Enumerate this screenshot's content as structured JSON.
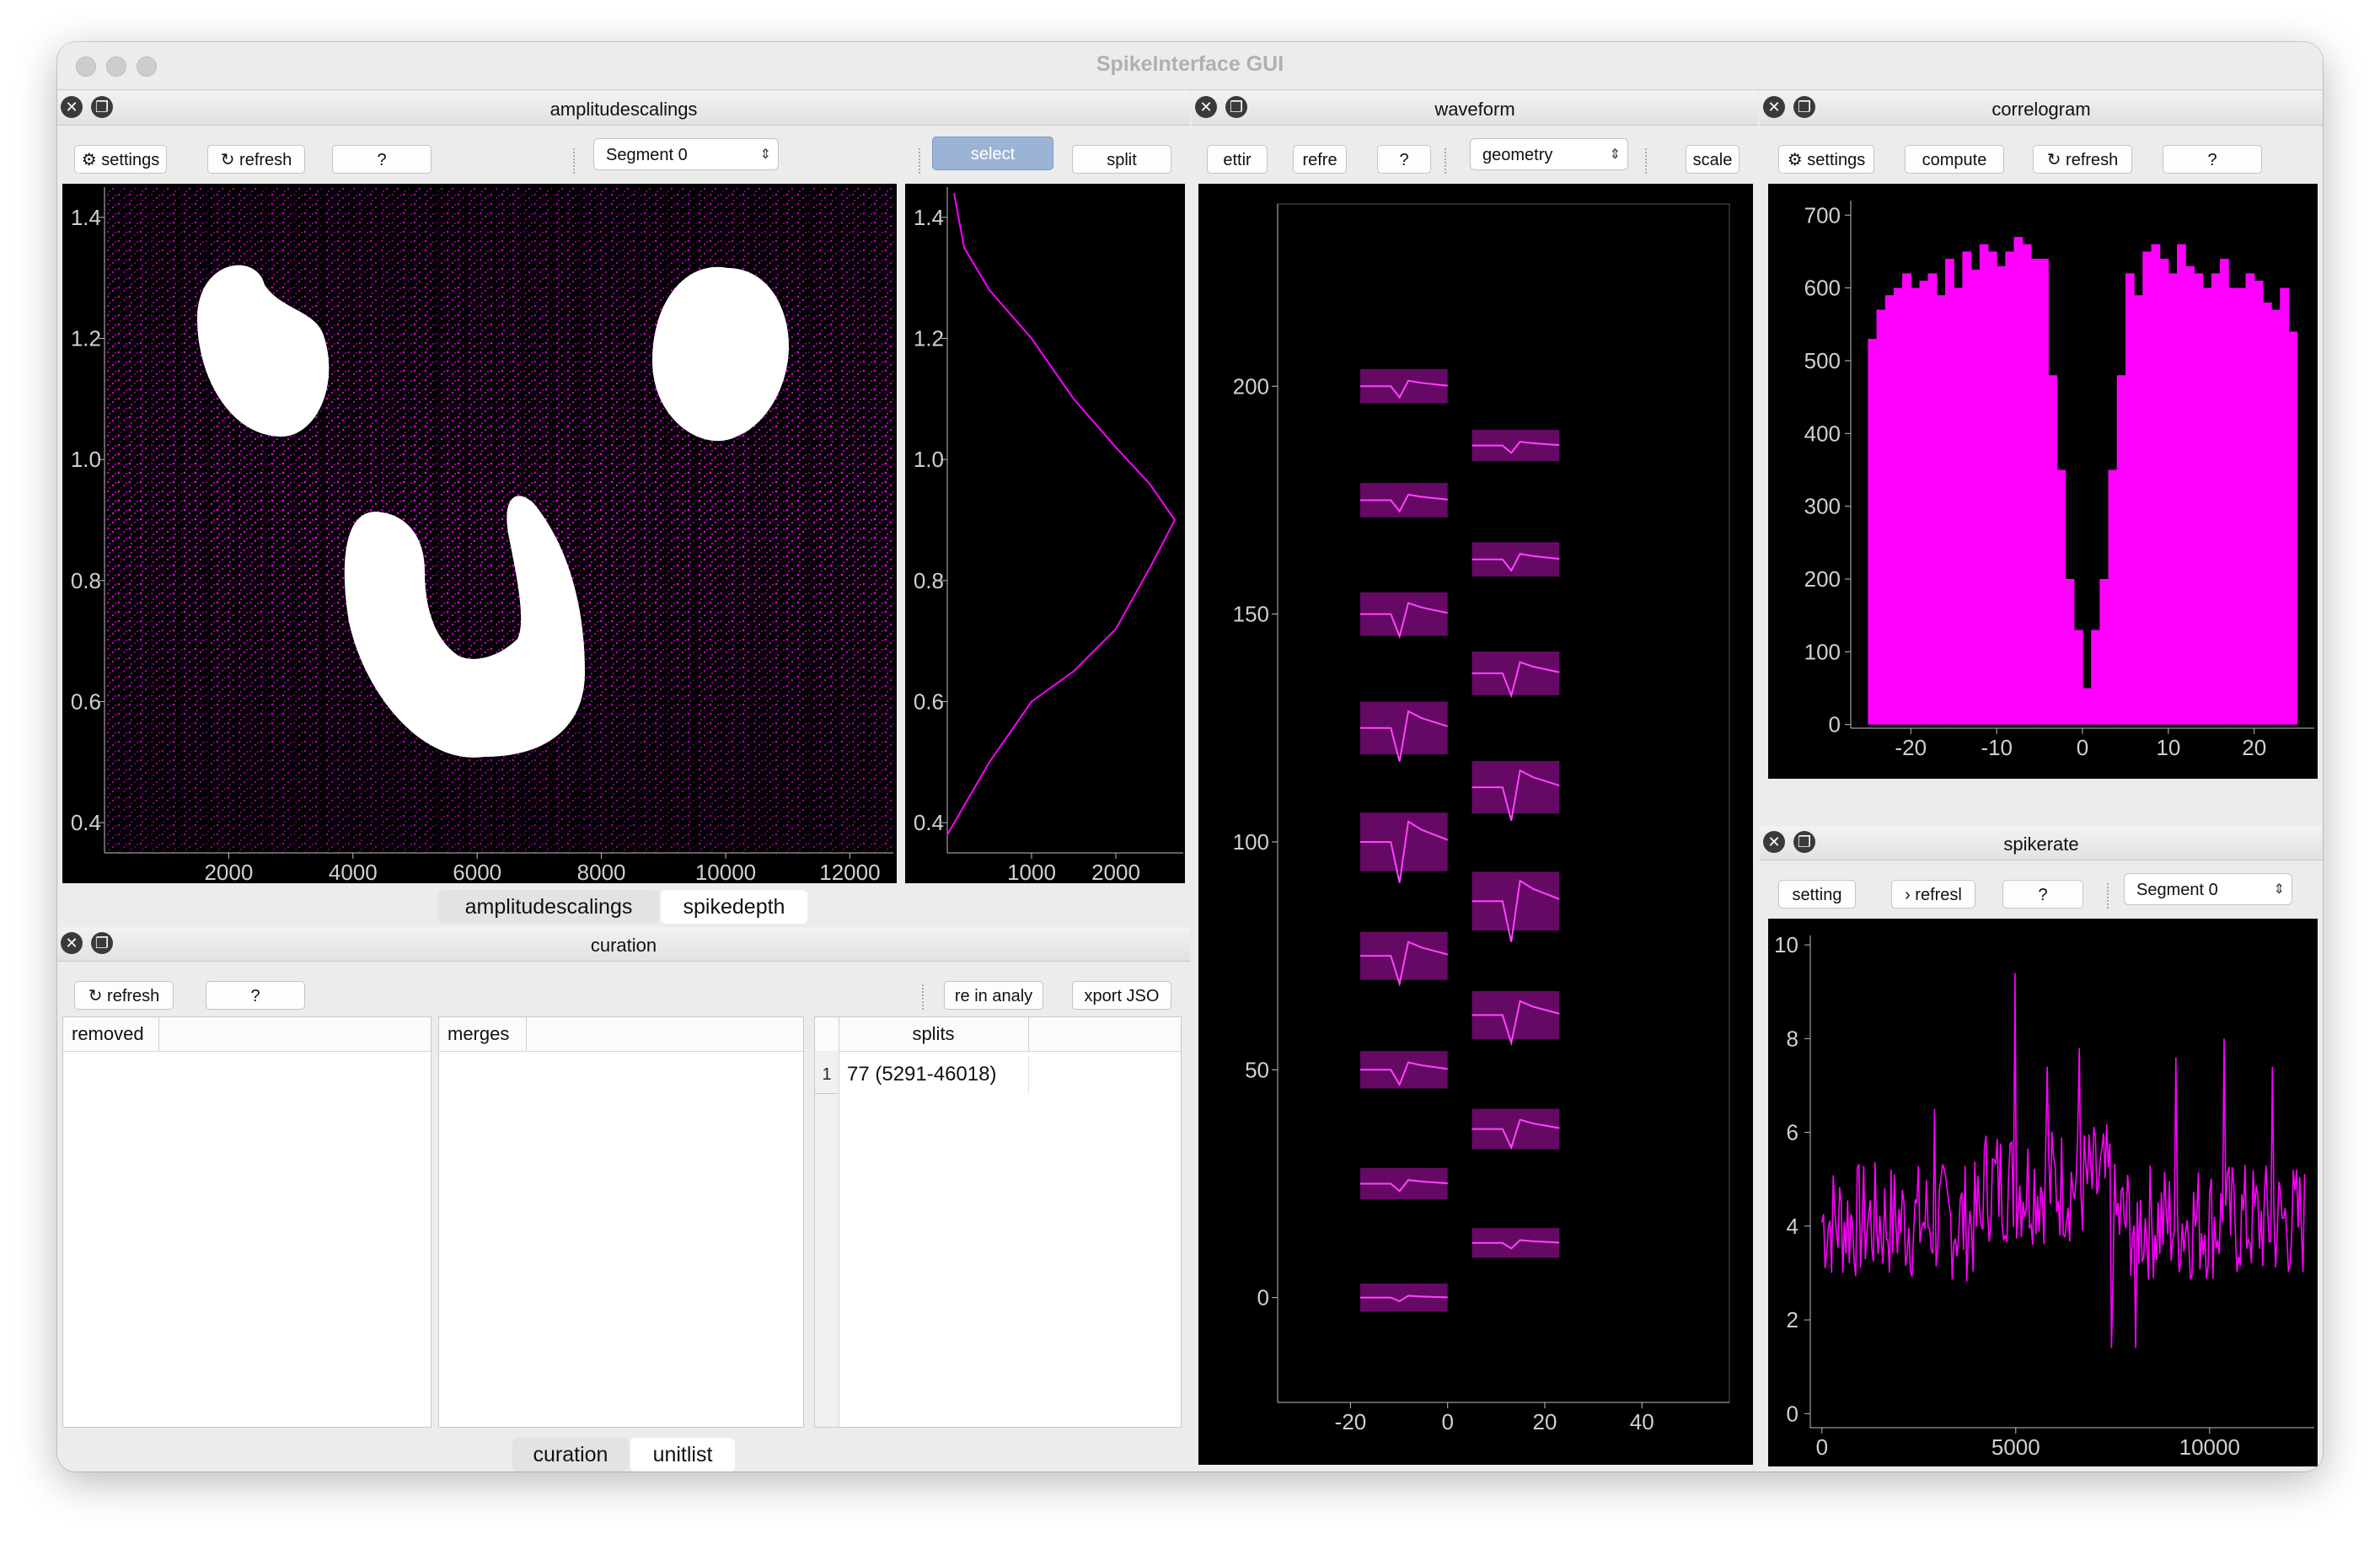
{
  "window": {
    "title": "SpikeInterface GUI"
  },
  "colors": {
    "accent": "#ff00ff",
    "plot_bg": "#000000",
    "axis": "#bfbfbf",
    "panel_bg": "#ececec"
  },
  "amplitudescalings": {
    "title": "amplitudescalings",
    "toolbar": {
      "settings": "⚙ settings",
      "refresh": "↻ refresh",
      "help": "?",
      "segment": "Segment 0",
      "select": "select",
      "split": "split"
    },
    "main_plot": {
      "x_ticks": [
        "2000",
        "4000",
        "6000",
        "8000",
        "10000",
        "12000"
      ],
      "y_ticks": [
        "1.4",
        "1.2",
        "1.0",
        "0.8",
        "0.6",
        "0.4"
      ]
    },
    "hist_plot": {
      "x_ticks": [
        "1000",
        "2000"
      ],
      "y_ticks": [
        "1.4",
        "1.2",
        "1.0",
        "0.8",
        "0.6",
        "0.4"
      ]
    }
  },
  "tabs_top": [
    "amplitudescalings",
    "spikedepth"
  ],
  "curation": {
    "title": "curation",
    "toolbar": {
      "refresh": "↻ refresh",
      "help": "?",
      "save": "re in analy",
      "export": "xport JSO"
    },
    "removed": {
      "header": "removed"
    },
    "merges": {
      "header": "merges"
    },
    "splits": {
      "header": "splits",
      "rows": [
        {
          "index": "1",
          "value": "77 (5291-46018)"
        }
      ]
    }
  },
  "tabs_bottom": [
    "curation",
    "unitlist"
  ],
  "waveform": {
    "title": "waveform",
    "toolbar": {
      "settings": "ettir",
      "refresh": "refre",
      "help": "?",
      "mode": "geometry",
      "scale": "scale"
    },
    "x_ticks": [
      "-20",
      "0",
      "20",
      "40"
    ],
    "y_ticks": [
      "200",
      "150",
      "100",
      "50",
      "0"
    ]
  },
  "correlogram": {
    "title": "correlogram",
    "toolbar": {
      "settings": "⚙ settings",
      "compute": "compute",
      "refresh": "↻ refresh",
      "help": "?"
    },
    "x_ticks": [
      "-20",
      "-10",
      "0",
      "10",
      "20"
    ],
    "y_ticks": [
      "700",
      "600",
      "500",
      "400",
      "300",
      "200",
      "100",
      "0"
    ]
  },
  "spikerate": {
    "title": "spikerate",
    "toolbar": {
      "settings": "setting",
      "refresh": "› refresl",
      "help": "?",
      "segment": "Segment 0"
    },
    "x_ticks": [
      "0",
      "5000",
      "10000"
    ],
    "y_ticks": [
      "10",
      "8",
      "6",
      "4",
      "2",
      "0"
    ]
  },
  "chart_data": [
    {
      "type": "scatter",
      "x": [
        2000,
        4000,
        6000,
        8000,
        10000,
        12000
      ],
      "y": [
        0.4,
        0.6,
        0.8,
        1.0,
        1.2,
        1.4
      ],
      "xlim": [
        0,
        12700
      ],
      "ylim": [
        0.35,
        1.45
      ]
    },
    {
      "type": "line",
      "x": [
        0,
        500,
        1000,
        1500,
        2000,
        2400,
        2700,
        2400,
        2000,
        1500,
        1000,
        500,
        200,
        80
      ],
      "y": [
        0.38,
        0.5,
        0.6,
        0.65,
        0.72,
        0.82,
        0.9,
        0.96,
        1.02,
        1.1,
        1.2,
        1.28,
        1.35,
        1.44
      ],
      "xlim": [
        0,
        2800
      ],
      "ylim": [
        0.35,
        1.45
      ]
    },
    {
      "type": "bar",
      "x": [
        -25,
        -24,
        -23,
        -22,
        -21,
        -20,
        -19,
        -18,
        -17,
        -16,
        -15,
        -14,
        -13,
        -12,
        -11,
        -10,
        -9,
        -8,
        -7,
        -6,
        -5,
        -4,
        -3,
        -2,
        -1,
        0,
        1,
        2,
        3,
        4,
        5,
        6,
        7,
        8,
        9,
        10,
        11,
        12,
        13,
        14,
        15,
        16,
        17,
        18,
        19,
        20,
        21,
        22,
        23,
        24
      ],
      "values": [
        530,
        570,
        590,
        600,
        620,
        600,
        610,
        620,
        590,
        640,
        600,
        650,
        625,
        660,
        650,
        630,
        650,
        670,
        660,
        640,
        640,
        480,
        350,
        200,
        130,
        50,
        130,
        200,
        350,
        480,
        620,
        590,
        650,
        660,
        640,
        620,
        660,
        630,
        620,
        600,
        620,
        640,
        600,
        600,
        620,
        610,
        580,
        570,
        600,
        540
      ],
      "xlim": [
        -27,
        27
      ],
      "ylim": [
        -5,
        720
      ]
    },
    {
      "type": "line",
      "x": [
        0,
        5000,
        10000
      ],
      "y": [
        4.5,
        9.4,
        4.0
      ],
      "xlim": [
        -300,
        12700
      ],
      "ylim": [
        -0.3,
        10.2
      ]
    }
  ]
}
